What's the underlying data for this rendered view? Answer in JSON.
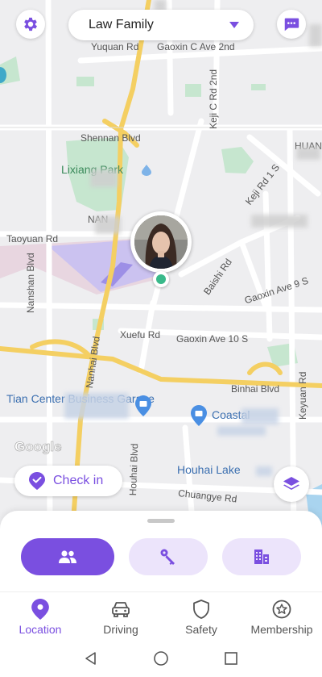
{
  "header": {
    "family_name": "Law Family",
    "settings_icon": "gear-icon",
    "chat_icon": "chat-bubble-icon"
  },
  "map": {
    "labels": {
      "yuquan": "Yuquan Rd",
      "gaoxin_c": "Gaoxin C Ave 2nd",
      "kejic": "Keji C Rd 2nd",
      "shennan": "Shennan Blvd",
      "huan": "HUAN",
      "lixiang": "Lixiang Park",
      "keji1s": "Keji Rd 1 S",
      "taoyuan": "Taoyuan Rd",
      "nanshan": "Nanshan Blvd",
      "baishi": "Baishi Rd",
      "gaoxin9s": "Gaoxin Ave 9 S",
      "xuefu": "Xuefu Rd",
      "gaoxin10s": "Gaoxin Ave 10 S",
      "nanhai": "Nanhai Blvd",
      "binhai": "Binhai Blvd",
      "keyuan": "Keyuan Rd",
      "tian": "Tian Center Business Garage",
      "coastal": "Coastal",
      "houhaiblvd": "Houhai Blvd",
      "houhailake": "Houhai Lake",
      "chuangye": "Chuangye Rd",
      "nan": "NAN"
    },
    "google": "Google",
    "checkin_label": "Check in",
    "layers_icon": "layers-icon"
  },
  "modes": [
    {
      "name": "people",
      "icon": "people-icon",
      "active": true
    },
    {
      "name": "keys",
      "icon": "keys-icon",
      "active": false
    },
    {
      "name": "places",
      "icon": "building-icon",
      "active": false
    }
  ],
  "tabs": [
    {
      "label": "Location",
      "icon": "location-pin-icon",
      "active": true
    },
    {
      "label": "Driving",
      "icon": "car-icon",
      "active": false
    },
    {
      "label": "Safety",
      "icon": "shield-icon",
      "active": false
    },
    {
      "label": "Membership",
      "icon": "star-badge-icon",
      "active": false
    }
  ],
  "colors": {
    "accent": "#7a4fe0",
    "accent_light": "#ece4fb",
    "map_bg": "#eeeef0",
    "road_yellow": "#f4cf62",
    "park_green": "#c6e6cf"
  }
}
